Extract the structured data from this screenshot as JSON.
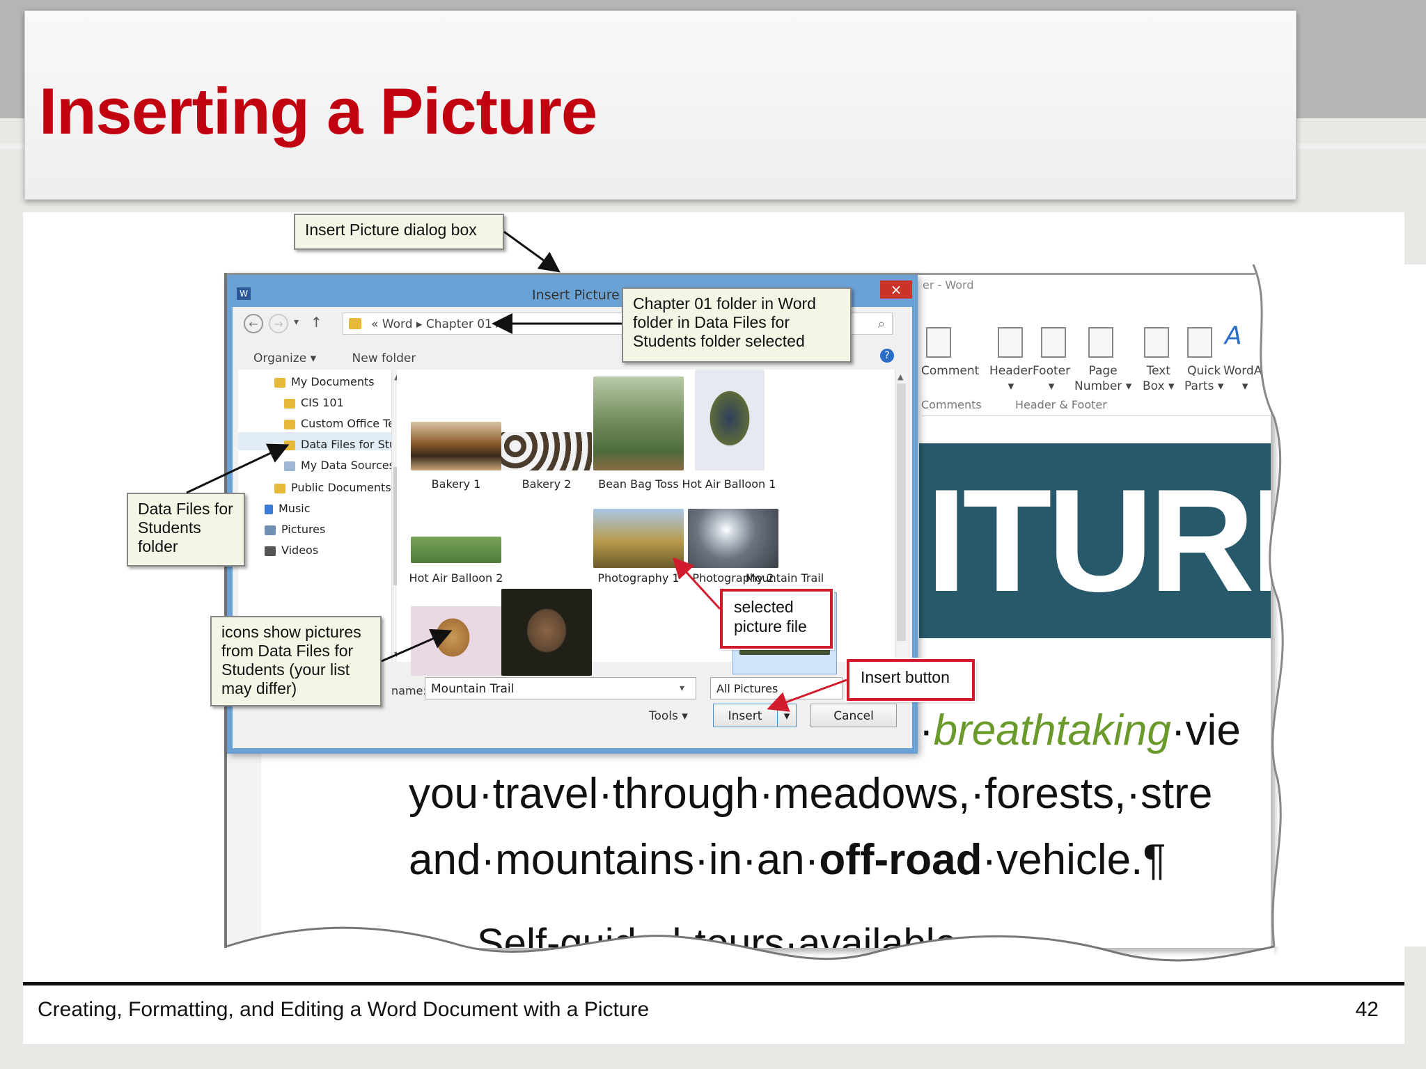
{
  "slide": {
    "title": "Inserting a Picture",
    "footer": "Creating, Formatting, and Editing a Word Document with a Picture",
    "page_number": "42"
  },
  "word_window": {
    "title_fragment": "er - Word",
    "ribbon": [
      {
        "label": "Comment",
        "sub": ""
      },
      {
        "label": "Header",
        "sub": "▾"
      },
      {
        "label": "Footer",
        "sub": "▾"
      },
      {
        "label": "Page",
        "sub": "Number ▾"
      },
      {
        "label": "Text",
        "sub": "Box ▾"
      },
      {
        "label": "Quick",
        "sub": "Parts ▾"
      },
      {
        "label": "WordAr",
        "sub": "▾"
      }
    ],
    "groups": [
      "Comments",
      "Header & Footer"
    ],
    "banner": "ITURE",
    "doc_line1_green": "breathtaking",
    "doc_line1_end": "·vie",
    "doc_line2": "you·travel·through·meadows,·forests,·stre",
    "doc_line3_a": "and·mountains·in·an·",
    "doc_line3_bold": "off-road",
    "doc_line3_b": "·vehicle.¶",
    "doc_cut": "Self-guided·tours·available"
  },
  "dialog": {
    "title": "Insert Picture",
    "close": "×",
    "app_icon": "W",
    "breadcrumb": "«  Word  ▸  Chapter 01  ▸",
    "toolbar": {
      "organize": "Organize ▾",
      "new_folder": "New folder"
    },
    "tree": [
      {
        "label": "My Documents",
        "indent": 0
      },
      {
        "label": "CIS 101",
        "indent": 1
      },
      {
        "label": "Custom Office Templat",
        "indent": 1
      },
      {
        "label": "Data Files for Students",
        "indent": 1
      },
      {
        "label": "My Data Sources",
        "indent": 1
      },
      {
        "label": "Public Documents",
        "indent": 0
      },
      {
        "label": "Music",
        "indent": 0
      },
      {
        "label": "Pictures",
        "indent": 0
      },
      {
        "label": "Videos",
        "indent": 0
      }
    ],
    "files": [
      "Bakery 1",
      "Bakery 2",
      "Bean Bag Toss",
      "Hot Air Balloon 1",
      "Hot Air Balloon 2",
      "Mountain Trail",
      "Photography 1",
      "Photography 2"
    ],
    "file_name_label": "name:",
    "file_name_value": "Mountain Trail",
    "filter": "All Pictures",
    "tools": "Tools",
    "insert": "Insert",
    "cancel": "Cancel"
  },
  "callouts": {
    "insert_picture_dialog": "Insert Picture dialog box",
    "chapter_folder": "Chapter 01 folder in Word folder in Data Files for Students folder selected",
    "data_files_folder": "Data Files for Students folder",
    "icons_show": "icons show pictures from Data Files for Students (your list may differ)",
    "selected_file": "selected picture file",
    "insert_button": "Insert button"
  },
  "colors": {
    "title_red": "#c10010",
    "dialog_blue": "#6aa2d6",
    "banner_teal": "#28596a",
    "callout_red": "#d11c2e"
  }
}
